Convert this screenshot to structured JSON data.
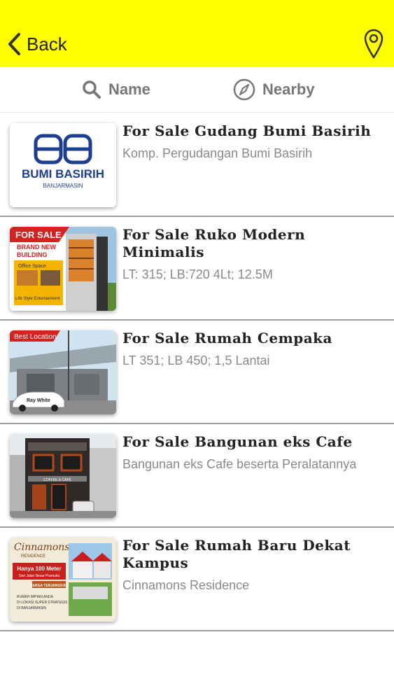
{
  "header": {
    "back_label": "Back",
    "back_icon": "chevron-left-icon",
    "location_icon": "map-pin-icon",
    "bg_color": "#ffff00"
  },
  "tabs": [
    {
      "label": "Name",
      "icon": "search-icon"
    },
    {
      "label": "Nearby",
      "icon": "compass-icon"
    }
  ],
  "listings": [
    {
      "title": "For Sale Gudang Bumi Basirih",
      "subtitle": "Komp. Pergudangan Bumi Basirih",
      "thumb": {
        "logo_text": "BUMI BASIRIH",
        "logo_sub": "BANJARMASIN"
      }
    },
    {
      "title": "For Sale Ruko Modern Minimalis",
      "subtitle": "LT: 315; LB:720 4Lt; 12.5M",
      "thumb": {
        "banner": "FOR SALE",
        "line1": "BRAND NEW",
        "line2": "BUILDING",
        "tag1": "Office Space",
        "tag2": "Life Style Entertainment"
      }
    },
    {
      "title": "For Sale Rumah Cempaka",
      "subtitle": "LT 351; LB 450; 1,5 Lantai",
      "thumb": {
        "banner": "Best Location",
        "car_text": "Ray White"
      }
    },
    {
      "title": "For Sale Bangunan eks Cafe",
      "subtitle": "Bangunan eks Cafe beserta Peralatannya",
      "thumb": {
        "sign": "COFFEE & CAFE"
      }
    },
    {
      "title": "For Sale Rumah Baru Dekat Kampus",
      "subtitle": "Cinnamons Residence",
      "thumb": {
        "brand": "Cinnamons",
        "brand_sub": "RESIDENCE",
        "line1": "Hanya 100 Meter",
        "line2": "Dari Jalan Besar Pramuka",
        "price": "HARGA TERJANGKAU",
        "quote1": "RUMAH IMPIAN ANDA",
        "quote2": "DI LOKASI SUPER STRATEGIS",
        "quote3": "DI BANJARMASIN"
      }
    }
  ]
}
